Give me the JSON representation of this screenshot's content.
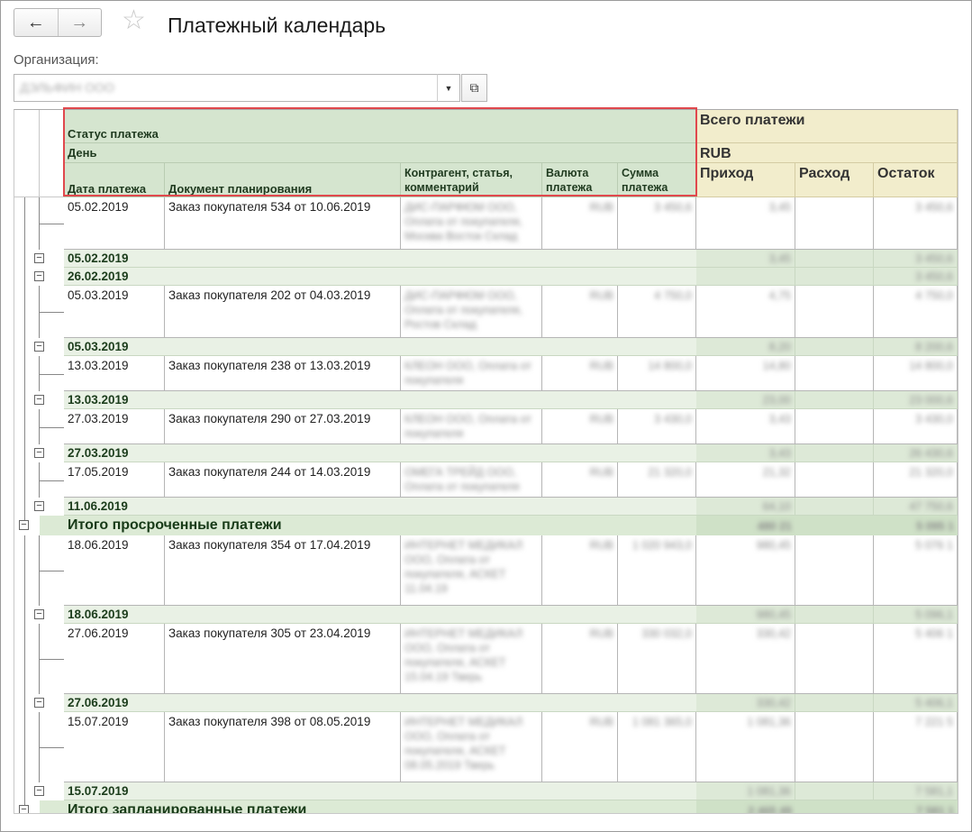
{
  "window": {
    "title": "Платежный календарь",
    "back_icon": "←",
    "forward_icon": "→",
    "star_icon": "☆"
  },
  "organization": {
    "label": "Организация:",
    "value": "ДЭЛЬФИН ООО",
    "dropdown_icon": "▼",
    "open_icon": "⧉"
  },
  "report": {
    "headers": {
      "status": "Статус платежа",
      "day": "День",
      "date": "Дата платежа",
      "document": "Документ планирования",
      "contractor": "Контрагент, статья, комментарий",
      "currency": "Валюта платежа",
      "sum": "Сумма платежа",
      "total": "Всего платежи",
      "currency_rub": "RUB",
      "income": "Приход",
      "expense": "Расход",
      "balance": "Остаток"
    },
    "rows": [
      {
        "date": "05.02.2019",
        "doc": "Заказ покупателя 534 от 10.06.2019",
        "contr": "ДИС-ПАРФЮМ ООО, Оплата от покупателя, Москва Восток Склад",
        "cur": "RUB",
        "sum": "3 450,6",
        "inc": "3,45",
        "exp": "",
        "bal": "3 450,6"
      },
      {
        "subtotal": "05.02.2019",
        "inc": "3,45",
        "bal": "3 450,6"
      },
      {
        "subtotal": "26.02.2019",
        "inc": "",
        "bal": "3 450,6"
      },
      {
        "date": "05.03.2019",
        "doc": "Заказ покупателя 202 от 04.03.2019",
        "contr": "ДИС-ПАРФЮМ ООО, Оплата от покупателя, Ростов Склад",
        "cur": "RUB",
        "sum": "4 750,0",
        "inc": "4,75",
        "exp": "",
        "bal": "4 750,0"
      },
      {
        "subtotal": "05.03.2019",
        "inc": "8,20",
        "bal": "8 200,6"
      },
      {
        "date": "13.03.2019",
        "doc": "Заказ покупателя 238 от 13.03.2019",
        "contr": "КЛЕОН ООО, Оплата от покупателя",
        "cur": "RUB",
        "sum": "14 800,0",
        "inc": "14,80",
        "exp": "",
        "bal": "14 800,0"
      },
      {
        "subtotal": "13.03.2019",
        "inc": "23,00",
        "bal": "23 000,6"
      },
      {
        "date": "27.03.2019",
        "doc": "Заказ покупателя 290 от 27.03.2019",
        "contr": "КЛЕОН ООО, Оплата от покупателя",
        "cur": "RUB",
        "sum": "3 430,0",
        "inc": "3,43",
        "exp": "",
        "bal": "3 430,0"
      },
      {
        "subtotal": "27.03.2019",
        "inc": "3,43",
        "bal": "26 430,6"
      },
      {
        "date": "17.05.2019",
        "doc": "Заказ покупателя 244 от 14.03.2019",
        "contr": "ОМЕГА ТРЕЙД ООО, Оплата от покупателя",
        "cur": "RUB",
        "sum": "21 320,0",
        "inc": "21,32",
        "exp": "",
        "bal": "21 320,0"
      },
      {
        "subtotal": "11.06.2019",
        "inc": "64,10",
        "bal": "47 750,6"
      },
      {
        "total": "Итого просроченные платежи",
        "inc": "480 21",
        "bal": "5 095 1"
      },
      {
        "date": "18.06.2019",
        "doc": "Заказ покупателя 354 от 17.04.2019",
        "contr": "ИНТЕРНЕТ МЕДИКАЛ ООО, Оплата от покупателя, АСКЕТ 11.04.19",
        "cur": "RUB",
        "sum": "1 020 943,0",
        "inc": "980,45",
        "exp": "",
        "bal": "5 076 1"
      },
      {
        "subtotal": "18.06.2019",
        "inc": "980,45",
        "bal": "5 096,1"
      },
      {
        "date": "27.06.2019",
        "doc": "Заказ покупателя 305 от 23.04.2019",
        "contr": "ИНТЕРНЕТ МЕДИКАЛ ООО, Оплата от покупателя, АСКЕТ 15.04.19 Тверь",
        "cur": "RUB",
        "sum": "330 032,0",
        "inc": "330,42",
        "exp": "",
        "bal": "5 406 1"
      },
      {
        "subtotal": "27.06.2019",
        "inc": "330,42",
        "bal": "5 406,1"
      },
      {
        "date": "15.07.2019",
        "doc": "Заказ покупателя 398 от 08.05.2019",
        "contr": "ИНТЕРНЕТ МЕДИКАЛ ООО, Оплата от покупателя, АСКЕТ 08.05.2019 Тверь",
        "cur": "RUB",
        "sum": "1 081 365,0",
        "inc": "1 081,36",
        "exp": "",
        "bal": "7 221 5"
      },
      {
        "subtotal": "15.07.2019",
        "inc": "1 081,36",
        "bal": "7 581,1"
      },
      {
        "total": "Итого запланированные платежи",
        "inc": "2 465 49",
        "bal": "7 581 1"
      }
    ]
  }
}
